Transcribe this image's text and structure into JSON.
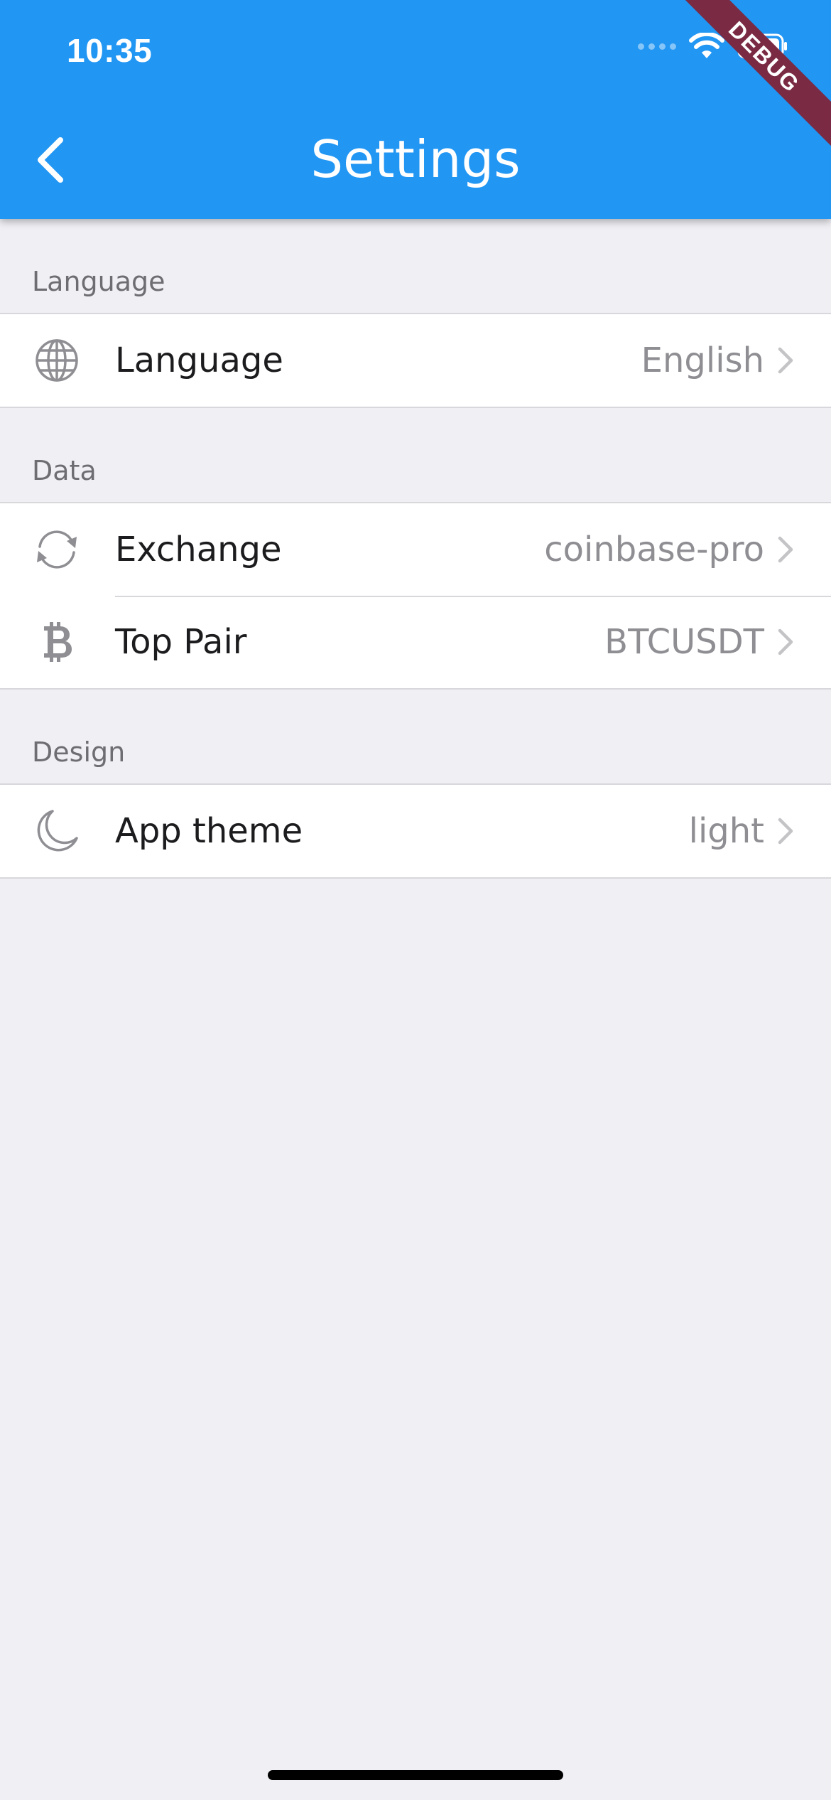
{
  "status_bar": {
    "time": "10:35"
  },
  "app_bar": {
    "title": "Settings",
    "back_icon": "chevron-left-icon",
    "color": "#2196f3"
  },
  "debug_banner": {
    "text": "DEBUG",
    "color": "#7a2a43"
  },
  "sections": [
    {
      "header": "Language",
      "rows": [
        {
          "icon": "globe-icon",
          "label": "Language",
          "value": "English"
        }
      ]
    },
    {
      "header": "Data",
      "rows": [
        {
          "icon": "sync-icon",
          "label": "Exchange",
          "value": "coinbase-pro"
        },
        {
          "icon": "bitcoin-icon",
          "label": "Top Pair",
          "value": "BTCUSDT"
        }
      ]
    },
    {
      "header": "Design",
      "rows": [
        {
          "icon": "moon-icon",
          "label": "App theme",
          "value": "light"
        }
      ]
    }
  ],
  "colors": {
    "background": "#efeff4",
    "row_value": "#8e8e93",
    "icon": "#8e8e93"
  }
}
